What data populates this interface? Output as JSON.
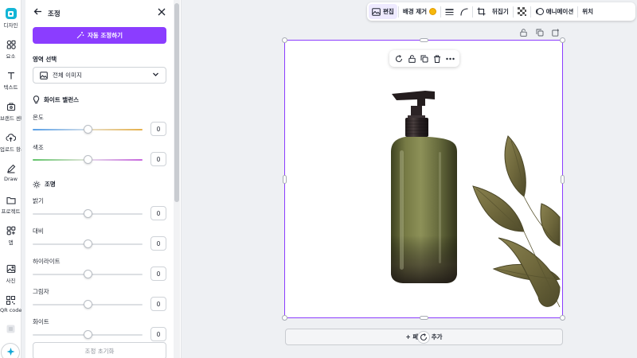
{
  "rail": {
    "items": [
      {
        "label": "디자인",
        "icon": "design-icon"
      },
      {
        "label": "요소",
        "icon": "elements-icon"
      },
      {
        "label": "텍스트",
        "icon": "text-icon"
      },
      {
        "label": "브랜드 센터",
        "icon": "brand-center-icon"
      },
      {
        "label": "업로드 항목",
        "icon": "uploads-icon"
      },
      {
        "label": "Draw",
        "icon": "draw-icon"
      },
      {
        "label": "프로젝트",
        "icon": "projects-icon"
      },
      {
        "label": "앱",
        "icon": "apps-icon"
      },
      {
        "label": "사진",
        "icon": "photos-icon"
      },
      {
        "label": "QR code",
        "icon": "qr-code-icon"
      }
    ]
  },
  "panel": {
    "title": "조정",
    "auto_adjust": "자동 조정하기",
    "area_label": "영역 선택",
    "area_value": "전체 이미지",
    "white_balance": "화이트 밸런스",
    "temperature": {
      "label": "온도",
      "value": "0",
      "level": 0.5
    },
    "tint": {
      "label": "색조",
      "value": "0",
      "level": 0.5
    },
    "light": "조명",
    "brightness": {
      "label": "밝기",
      "value": "0",
      "level": 0.5
    },
    "contrast": {
      "label": "대비",
      "value": "0",
      "level": 0.5
    },
    "highlights": {
      "label": "하이라이트",
      "value": "0",
      "level": 0.5
    },
    "shadows": {
      "label": "그림자",
      "value": "0",
      "level": 0.5
    },
    "whites": {
      "label": "화이트",
      "value": "0",
      "level": 0.5
    },
    "reset": "조정 초기화"
  },
  "toolbar": {
    "edit": "편집",
    "bg_remove": "배경 제거",
    "flip": "뒤집기",
    "animate": "애니메이션",
    "position": "위치"
  },
  "canvas": {
    "add_page": "+ 페이지 추가"
  },
  "colors": {
    "accent": "#8b3dff",
    "brand_tile": "#13b5d6"
  }
}
